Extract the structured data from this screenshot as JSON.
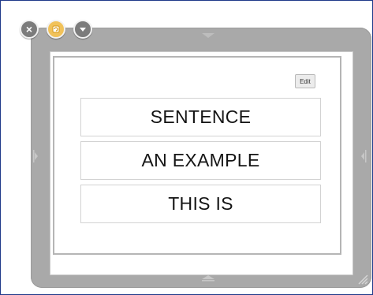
{
  "controls": {
    "close_icon": "close-icon",
    "close_glyph": "×",
    "refresh_icon": "refresh-icon",
    "minimize_icon": "chevron-down-icon"
  },
  "edit_button": {
    "label": "Edit"
  },
  "rows": [
    {
      "text": "SENTENCE"
    },
    {
      "text": "AN EXAMPLE"
    },
    {
      "text": "THIS IS"
    }
  ],
  "colors": {
    "frame_border": "#1f3a8a",
    "shell_gray": "#a9a9a9",
    "refresh_accent": "#f1c25a"
  }
}
